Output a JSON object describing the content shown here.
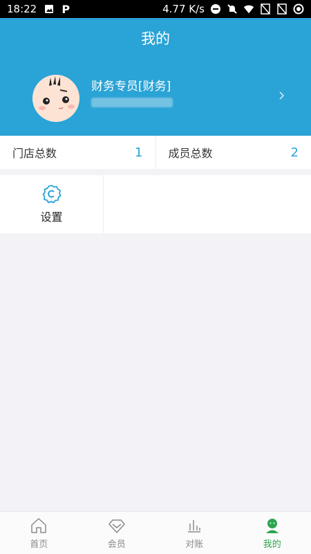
{
  "status_bar": {
    "time": "18:22",
    "speed": "4.77 K/s",
    "left_icons": [
      "image-icon",
      "p-icon"
    ],
    "right_icons": [
      "dnd-icon",
      "bell-off-icon",
      "wifi-icon",
      "no-sim-icon",
      "no-sim-icon",
      "data-saver-icon"
    ],
    "p_letter": "P"
  },
  "header": {
    "title": "我的",
    "profile": {
      "name": "财务专员[财务]",
      "avatar_icon": "avatar-face-icon",
      "chevron_icon": "chevron-right-icon"
    },
    "background_color": "#2aa3d6"
  },
  "stats": [
    {
      "label": "门店总数",
      "value": "1"
    },
    {
      "label": "成员总数",
      "value": "2"
    }
  ],
  "grid": [
    {
      "label": "设置",
      "icon": "settings-icon"
    }
  ],
  "tabbar": {
    "items": [
      {
        "label": "首页",
        "icon": "home-icon",
        "active": false
      },
      {
        "label": "会员",
        "icon": "diamond-icon",
        "active": false
      },
      {
        "label": "对账",
        "icon": "bar-chart-icon",
        "active": false
      },
      {
        "label": "我的",
        "icon": "user-icon",
        "active": true
      }
    ],
    "active_color": "#2ea44f"
  }
}
